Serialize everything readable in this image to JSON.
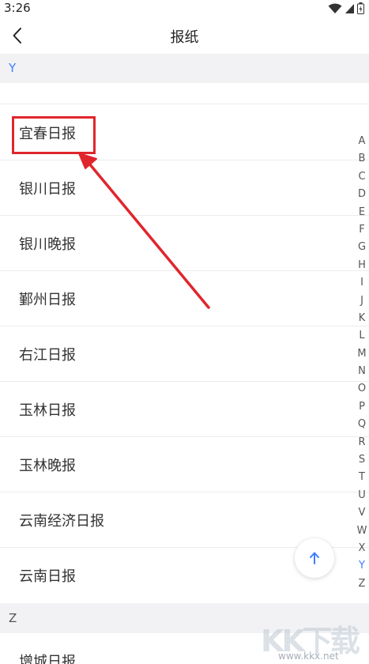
{
  "status_bar": {
    "time": "3:26",
    "icons": [
      "wifi-icon",
      "signal-icon",
      "battery-icon"
    ]
  },
  "nav": {
    "title": "报纸",
    "back_icon": "back-arrow-icon"
  },
  "sections": {
    "y_header": "Y",
    "z_header": "Z"
  },
  "list": {
    "partial_top_label": "",
    "items": [
      "宜春日报",
      "银川日报",
      "银川晚报",
      "鄞州日报",
      "右江日报",
      "玉林日报",
      "玉林晚报",
      "云南经济日报",
      "云南日报"
    ],
    "partial_bottom_label": "增城日报"
  },
  "index_bar": {
    "letters": [
      "A",
      "B",
      "C",
      "D",
      "E",
      "F",
      "G",
      "H",
      "I",
      "J",
      "K",
      "L",
      "M",
      "N",
      "O",
      "P",
      "Q",
      "R",
      "S",
      "T",
      "U",
      "V",
      "W",
      "X",
      "Y",
      "Z"
    ],
    "active": "Y"
  },
  "scroll_top_icon": "arrow-up-icon",
  "annotation": {
    "highlight_color": "#e0262c",
    "highlighted_item": "宜春日报"
  },
  "watermark": {
    "logo": "KK下载",
    "url": "www.kkx.net"
  },
  "colors": {
    "accent": "#3d7dff",
    "section_bg": "#f2f2f4",
    "annotation": "#e0262c"
  }
}
